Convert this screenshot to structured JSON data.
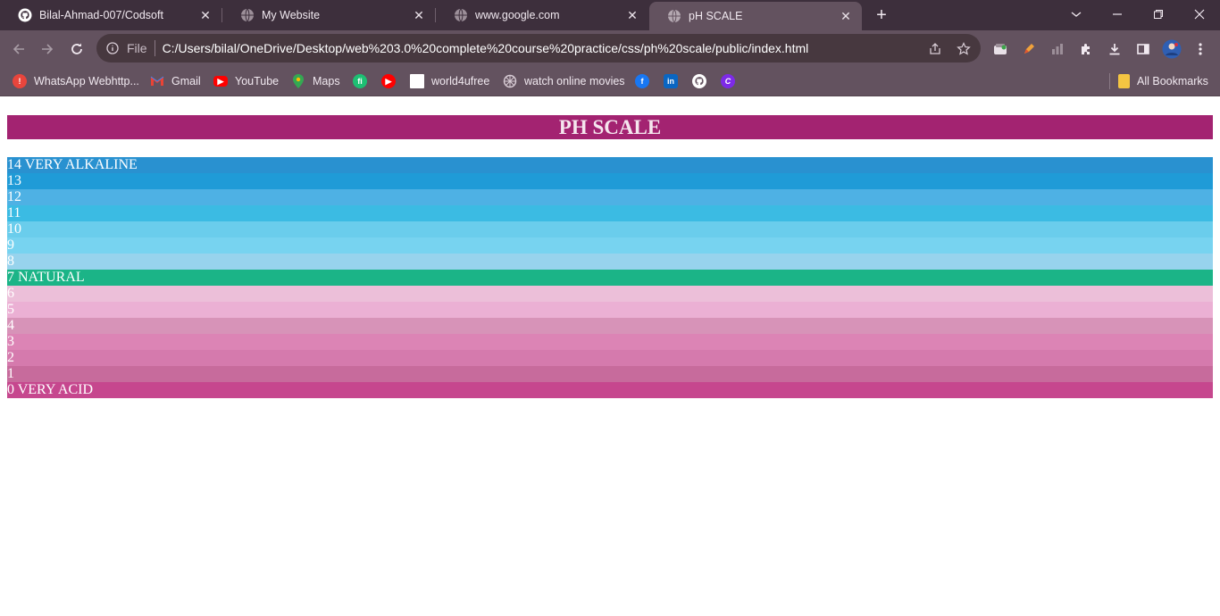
{
  "tabs": [
    {
      "title": "Bilal-Ahmad-007/Codsoft",
      "icon": "github-icon"
    },
    {
      "title": "My Website",
      "icon": "globe-icon"
    },
    {
      "title": "www.google.com",
      "icon": "globe-icon"
    },
    {
      "title": "pH SCALE",
      "icon": "globe-icon",
      "active": true
    }
  ],
  "omnibox": {
    "scheme": "File",
    "url": "C:/Users/bilal/OneDrive/Desktop/web%203.0%20complete%20course%20practice/css/ph%20scale/public/index.html"
  },
  "bookmarks": [
    {
      "label": "WhatsApp Webhttp...",
      "icon": "whatsapp-icon",
      "color": "#e8453c"
    },
    {
      "label": "Gmail",
      "icon": "gmail-icon",
      "color": "#ea4335"
    },
    {
      "label": "YouTube",
      "icon": "youtube-icon",
      "color": "#ff0000"
    },
    {
      "label": "Maps",
      "icon": "maps-icon",
      "color": "#34a853"
    },
    {
      "label": "",
      "icon": "fiverr-icon",
      "color": "#1dbf73"
    },
    {
      "label": "",
      "icon": "youtube-icon",
      "color": "#ff0000"
    },
    {
      "label": "world4ufree",
      "icon": "page-icon",
      "color": "#ffffff"
    },
    {
      "label": "watch online movies",
      "icon": "film-icon",
      "color": "#d8ccd5"
    },
    {
      "label": "",
      "icon": "facebook-icon",
      "color": "#1877f2"
    },
    {
      "label": "",
      "icon": "linkedin-icon",
      "color": "#0a66c2"
    },
    {
      "label": "",
      "icon": "github-icon",
      "color": "#ffffff"
    },
    {
      "label": "",
      "icon": "canva-icon",
      "color": "#7d2ae8"
    }
  ],
  "all_bookmarks_label": "All Bookmarks",
  "page": {
    "heading": "PH SCALE",
    "rows": [
      {
        "label": "14 VERY ALKALINE",
        "color": "#2991d0"
      },
      {
        "label": "13",
        "color": "#1f9bd7"
      },
      {
        "label": "12",
        "color": "#4eb1e4"
      },
      {
        "label": "11",
        "color": "#3bbbe3"
      },
      {
        "label": "10",
        "color": "#6acdec"
      },
      {
        "label": "9",
        "color": "#77d3f0"
      },
      {
        "label": "8",
        "color": "#97d3ed"
      },
      {
        "label": "7 NATURAL",
        "color": "#1bb487"
      },
      {
        "label": "6",
        "color": "#ecbfd9"
      },
      {
        "label": "5",
        "color": "#ebb0d4"
      },
      {
        "label": "4",
        "color": "#d793b8"
      },
      {
        "label": "3",
        "color": "#dc84b5"
      },
      {
        "label": "2",
        "color": "#d57aad"
      },
      {
        "label": "1",
        "color": "#c76b9c"
      },
      {
        "label": "0 VERY ACID",
        "color": "#c6478e"
      }
    ]
  }
}
